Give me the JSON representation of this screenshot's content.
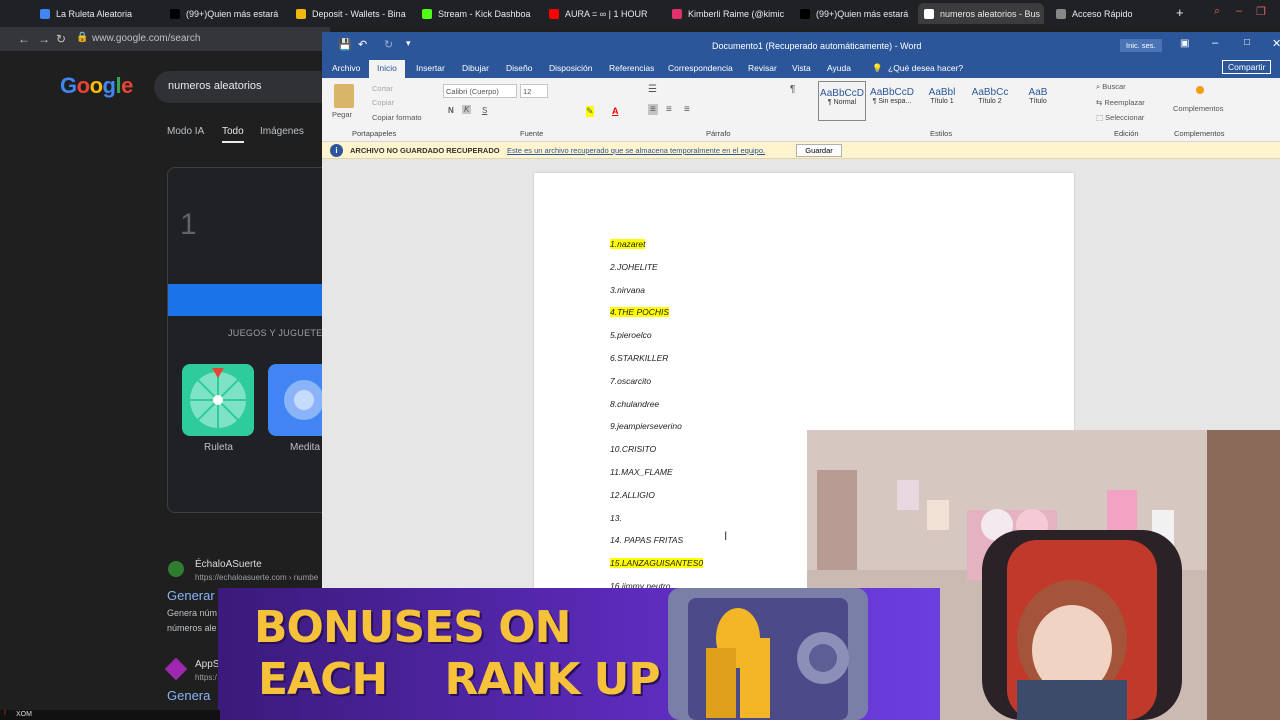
{
  "browser": {
    "tabs": [
      {
        "title": "La Ruleta Aleatoria",
        "color": "#4285f4"
      },
      {
        "title": "(99+)Quien más estará",
        "color": "#000000"
      },
      {
        "title": "Deposit - Wallets - Bina",
        "color": "#f0b90b"
      },
      {
        "title": "Stream - Kick Dashboa",
        "color": "#53fc18"
      },
      {
        "title": "AURA = ∞ | 1 HOUR",
        "color": "#ff0000"
      },
      {
        "title": "Kimberli Raime (@kimic",
        "color": "#e1306c"
      },
      {
        "title": "(99+)Quien más estará",
        "color": "#000000"
      },
      {
        "title": "numeros aleatorios - Bus",
        "color": "#ffffff"
      },
      {
        "title": "Acceso Rápido",
        "color": "#888888"
      }
    ],
    "new_tab": "+",
    "url": "www.google.com/search"
  },
  "google": {
    "logo": "Google",
    "query": "numeros aleatorios",
    "tabs": [
      "Modo IA",
      "Todo",
      "Imágenes"
    ],
    "rng_value": "1",
    "games_label": "JUEGOS Y JUGUETE",
    "games": [
      "Ruleta",
      "Medita"
    ],
    "result1": {
      "site": "ÉchaloASuerte",
      "url": "https://echaloasuerte.com › numbe",
      "title": "Generar",
      "snippet1": "Genera núm",
      "snippet2": "números ale"
    },
    "result2": {
      "site": "AppS",
      "url": "https:/",
      "title": "Genera"
    }
  },
  "word": {
    "title": "Documento1 (Recuperado automáticamente) - Word",
    "signin": "Inic. ses.",
    "menu": [
      "Archivo",
      "Inicio",
      "Insertar",
      "Dibujar",
      "Diseño",
      "Disposición",
      "Referencias",
      "Correspondencia",
      "Revisar",
      "Vista",
      "Ayuda",
      "¿Qué desea hacer?"
    ],
    "share": "Compartir",
    "clipboard": {
      "paste": "Pegar",
      "cut": "Cortar",
      "copy": "Copiar",
      "format": "Copiar formato",
      "label": "Portapapeles"
    },
    "font": {
      "name": "Calibri (Cuerpo)",
      "size": "12",
      "label": "Fuente"
    },
    "paragraph_label": "Párrafo",
    "styles": [
      {
        "preview": "AaBbCcD",
        "name": "¶ Normal"
      },
      {
        "preview": "AaBbCcD",
        "name": "¶ Sin espa..."
      },
      {
        "preview": "AaBbl",
        "name": "Título 1"
      },
      {
        "preview": "AaBbCc",
        "name": "Título 2"
      },
      {
        "preview": "AaB",
        "name": "Título"
      }
    ],
    "styles_label": "Estilos",
    "editing": {
      "find": "Buscar",
      "replace": "Reemplazar",
      "select": "Seleccionar",
      "label": "Edición"
    },
    "addins": {
      "button": "Complementos",
      "label": "Complementos"
    },
    "infobar": {
      "title": "ARCHIVO NO GUARDADO RECUPERADO",
      "message": "Este es un archivo recuperado que se almacena temporalmente en el equipo.",
      "button": "Guardar"
    },
    "lines": [
      {
        "text": "1.nazaret",
        "highlight": true
      },
      {
        "text": "2.JOHELITE",
        "highlight": false
      },
      {
        "text": "3.nirvana",
        "highlight": false
      },
      {
        "text": "4.THE POCHIS",
        "highlight": true
      },
      {
        "text": "5.pieroelco",
        "highlight": false
      },
      {
        "text": "6.STARKILLER",
        "highlight": false
      },
      {
        "text": "7.oscarcito",
        "highlight": false
      },
      {
        "text": "8.chulandree",
        "highlight": false
      },
      {
        "text": "9.jeampierseverino",
        "highlight": false
      },
      {
        "text": "10.CRISITO",
        "highlight": false
      },
      {
        "text": "11.MAX_FLAME",
        "highlight": false
      },
      {
        "text": "12.ALLIGIO",
        "highlight": false
      },
      {
        "text": "13.",
        "highlight": false
      },
      {
        "text": "14. PAPAS FRITAS",
        "highlight": false
      },
      {
        "text": "15.LANZAGUISANTES0",
        "highlight": true
      },
      {
        "text": "16.jimmy neutro",
        "highlight": false
      }
    ]
  },
  "banner": {
    "line1": "BONUSES ON",
    "line2": "EACH    RANK UP"
  },
  "taskbar": {
    "label": "XOM"
  }
}
